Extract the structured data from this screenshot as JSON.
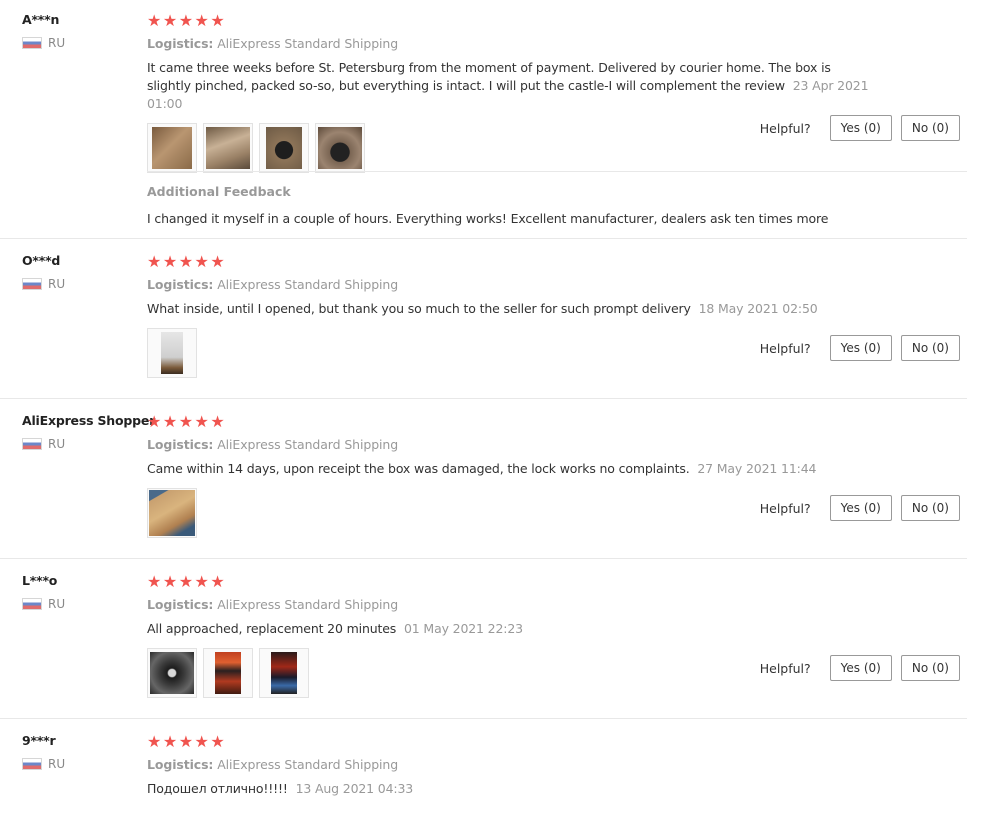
{
  "reviews": [
    {
      "user": "A***n",
      "country": "RU",
      "stars": 5,
      "logistics_label": "Logistics:",
      "logistics_value": "AliExpress Standard Shipping",
      "text": "It came three weeks before St. Petersburg from the moment of payment. Delivered by courier home. The box is slightly pinched, packed so-so, but everything is intact. I will put the castle-I will complement the review",
      "date": "23 Apr 2021 01:00",
      "photos": 4,
      "helpful_label": "Helpful?",
      "yes_label": "Yes (0)",
      "no_label": "No (0)",
      "additional_title": "Additional Feedback",
      "additional_text": "I changed it myself in a couple of hours. Everything works! Excellent manufacturer, dealers ask ten times more"
    },
    {
      "user": "O***d",
      "country": "RU",
      "stars": 5,
      "logistics_label": "Logistics:",
      "logistics_value": "AliExpress Standard Shipping",
      "text": "What inside, until I opened, but thank you so much to the seller for such prompt delivery",
      "date": "18 May 2021 02:50",
      "photos": 1,
      "helpful_label": "Helpful?",
      "yes_label": "Yes (0)",
      "no_label": "No (0)"
    },
    {
      "user": "AliExpress Shopper",
      "country": "RU",
      "stars": 5,
      "logistics_label": "Logistics:",
      "logistics_value": "AliExpress Standard Shipping",
      "text": "Came within 14 days, upon receipt the box was damaged, the lock works no complaints.",
      "date": "27 May 2021 11:44",
      "photos": 1,
      "helpful_label": "Helpful?",
      "yes_label": "Yes (0)",
      "no_label": "No (0)"
    },
    {
      "user": "L***o",
      "country": "RU",
      "stars": 5,
      "logistics_label": "Logistics:",
      "logistics_value": "AliExpress Standard Shipping",
      "text": "All approached, replacement 20 minutes",
      "date": "01 May 2021 22:23",
      "photos": 3,
      "helpful_label": "Helpful?",
      "yes_label": "Yes (0)",
      "no_label": "No (0)"
    },
    {
      "user": "9***r",
      "country": "RU",
      "stars": 5,
      "logistics_label": "Logistics:",
      "logistics_value": "AliExpress Standard Shipping",
      "text": "Подошел отлично!!!!!",
      "date": "13 Aug 2021 04:33",
      "photos": 0
    }
  ],
  "colors": {
    "star": "#f0544f",
    "muted_text": "#999999",
    "border": "#e8e8e8"
  }
}
